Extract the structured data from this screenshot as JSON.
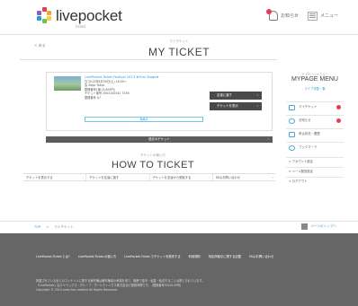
{
  "header": {
    "logo_text": "livepocket",
    "logo_sub": "ticket",
    "notice_label": "お知らせ",
    "menu_label": "メニュー"
  },
  "page": {
    "back_label": "< 戻る",
    "title_sub": "マイチケット",
    "title": "MY TICKET"
  },
  "ticket": {
    "event_title": "LivePocket-Ticket-Festival 2013 ★First Stage★",
    "lines": [
      "日 2013年5月30日(土) 16:00〜",
      "会 Zepp Tokyo",
      "整理番号1番 (3,000円)",
      "チケット番号 2003100041 7536",
      "整理番号 A7"
    ],
    "status": "発券済",
    "buttons": [
      "友達に渡す",
      "チケットを表示"
    ]
  },
  "past_ticket_bar": "過去のチケット",
  "howto": {
    "sub": "チケットの使い方",
    "title": "HOW TO TICKET",
    "tabs": [
      "チケットを表示する",
      "チケットを友達に渡す",
      "チケットを友達から受取する",
      "FAQ/お問い合わせ"
    ]
  },
  "side_menu": {
    "sub": "マイページメニュー",
    "title": "MYPAGE MENU",
    "sub2": "ライブ手配・集",
    "items": [
      {
        "label": "マイチケット",
        "badge": true
      },
      {
        "label": "お知らせ",
        "badge": true
      },
      {
        "label": "申込状況・履歴",
        "badge": false
      },
      {
        "label": "ブックマーク",
        "badge": false
      }
    ],
    "links": [
      "> アカウント設定",
      "> メール配信設定",
      "> ログアウト"
    ]
  },
  "breadcrumb": {
    "items": [
      "TOP",
      ">",
      "マイチケット"
    ],
    "pagetop": "ページのトップへ"
  },
  "footer": {
    "links": [
      "LivePocket-Ticket-とは?",
      "LivePocket-Ticket-の使い方",
      "LivePocket-Ticket-でチケットを販売する",
      "利用規約",
      "特定商取引に関する記載",
      "FAQ/お問い合わせ"
    ],
    "text_lines": [
      "掲載されている全てのコンテンツに関する著作権は著作権者の承諾を得て、無断で複写・転載・転送することは禁じられています。",
      "「LivePocket」はエイベックス・グループ・ホールディングス株式会社の登録商標です。 (登録番号5020145号)",
      "Copyright © 2014 avex live creative All Rights Reserved."
    ]
  },
  "colors": {
    "accent": "#2a9bd6",
    "badge": "#e83b5a",
    "footer_bg": "#666666",
    "dark_button": "#4a4a4a"
  }
}
